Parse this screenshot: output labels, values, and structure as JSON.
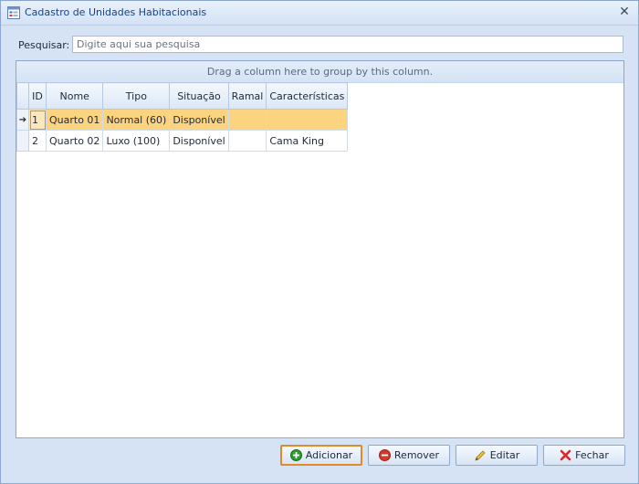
{
  "window": {
    "title": "Cadastro de Unidades Habitacionais",
    "close_glyph": "✕"
  },
  "search": {
    "label": "Pesquisar:",
    "placeholder": "Digite aqui sua pesquisa",
    "value": ""
  },
  "grid": {
    "group_panel_text": "Drag a column here to group by this column.",
    "columns": [
      "ID",
      "Nome",
      "Tipo",
      "Situação",
      "Ramal",
      "Características"
    ],
    "selected_row_index": 0,
    "rows": [
      {
        "indicator": "➔",
        "id": "1",
        "nome": "Quarto 01",
        "tipo": "Normal (60)",
        "situacao": "Disponível",
        "ramal": "",
        "caracteristicas": ""
      },
      {
        "indicator": "",
        "id": "2",
        "nome": "Quarto 02",
        "tipo": "Luxo (100)",
        "situacao": "Disponível",
        "ramal": "",
        "caracteristicas": "Cama King"
      }
    ]
  },
  "buttons": {
    "add": {
      "label": "Adicionar",
      "icon": "plus-circle-icon",
      "color": "#2e9a2e"
    },
    "remove": {
      "label": "Remover",
      "icon": "minus-circle-icon",
      "color": "#d43a2a"
    },
    "edit": {
      "label": "Editar",
      "icon": "pencil-icon",
      "color": "#e8b030"
    },
    "close": {
      "label": "Fechar",
      "icon": "x-icon",
      "color": "#d42a2a"
    }
  }
}
